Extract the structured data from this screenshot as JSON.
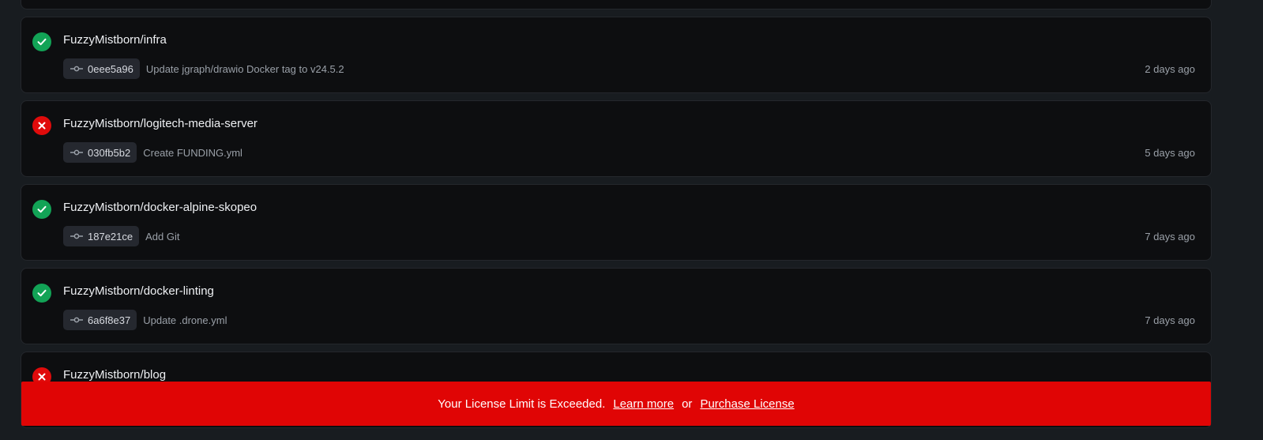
{
  "builds": [
    {
      "status": "success",
      "status_icon": "check-icon",
      "repo": "",
      "sha": "",
      "message": "",
      "time": ""
    },
    {
      "status": "success",
      "status_icon": "check-icon",
      "repo": "FuzzyMistborn/infra",
      "sha": "0eee5a96",
      "message": "Update jgraph/drawio Docker tag to v24.5.2",
      "time": "2 days ago"
    },
    {
      "status": "failure",
      "status_icon": "x-icon",
      "repo": "FuzzyMistborn/logitech-media-server",
      "sha": "030fb5b2",
      "message": "Create FUNDING.yml",
      "time": "5 days ago"
    },
    {
      "status": "success",
      "status_icon": "check-icon",
      "repo": "FuzzyMistborn/docker-alpine-skopeo",
      "sha": "187e21ce",
      "message": "Add Git",
      "time": "7 days ago"
    },
    {
      "status": "success",
      "status_icon": "check-icon",
      "repo": "FuzzyMistborn/docker-linting",
      "sha": "6a6f8e37",
      "message": "Update .drone.yml",
      "time": "7 days ago"
    },
    {
      "status": "failure",
      "status_icon": "x-icon",
      "repo": "FuzzyMistborn/blog",
      "sha": "",
      "message": "",
      "time": ""
    }
  ],
  "license_banner": {
    "message": "Your License Limit is Exceeded.",
    "learn_more": "Learn more",
    "separator": "or",
    "purchase": "Purchase License"
  },
  "colors": {
    "success": "#12a356",
    "failure": "#e00b0b",
    "banner": "#e00505",
    "card_background": "#0d0e10",
    "page_background": "#181c20"
  }
}
